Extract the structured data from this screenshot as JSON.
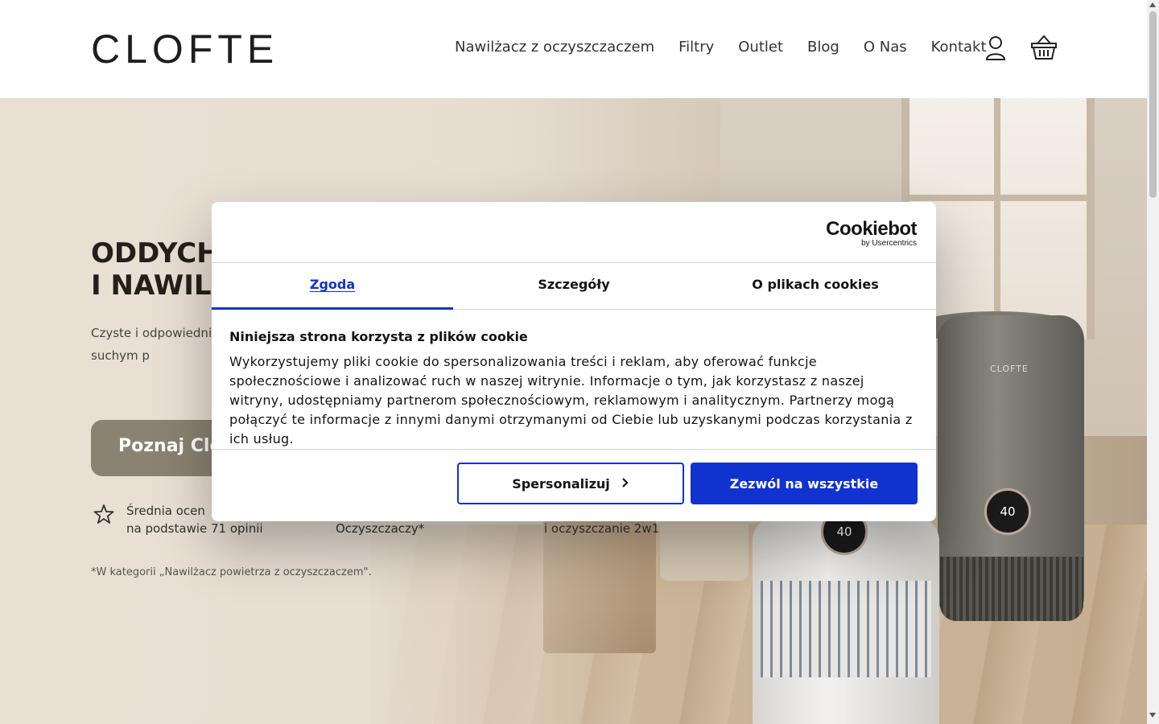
{
  "header": {
    "logo": "CLOFTE",
    "nav": [
      {
        "label": "Nawilżacz z oczyszczaczem"
      },
      {
        "label": "Filtry"
      },
      {
        "label": "Outlet"
      },
      {
        "label": "Blog"
      },
      {
        "label": "O Nas"
      },
      {
        "label": "Kontakt"
      }
    ],
    "icons": [
      "user-icon",
      "cart-icon"
    ]
  },
  "hero": {
    "title_line1": "ODDYCHA",
    "title_line2": "I NAWILŻ",
    "description": "Czyste i odpowiedni ograniczyć suchość związany z suchym p",
    "cta_label": "Poznaj Clo",
    "features": [
      {
        "line1": "Średnia ocen",
        "line2": "na podstawie 71 opinii",
        "icon": "star-icon"
      },
      {
        "line1": "",
        "line2": "Oczyszczaczy*"
      },
      {
        "line1": "",
        "line2": "i oczyszczanie 2w1"
      }
    ],
    "footnote": "*W kategorii „Nawilżacz powietrza z oczyszczaczem\".",
    "device_label": "CLOFTE",
    "display_value": "40"
  },
  "cookie": {
    "brand": "Cookiebot",
    "brand_sub": "by Usercentrics",
    "tabs": [
      {
        "label": "Zgoda",
        "active": true
      },
      {
        "label": "Szczegóły",
        "active": false
      },
      {
        "label": "O plikach cookies",
        "active": false
      }
    ],
    "heading": "Niniejsza strona korzysta z plików cookie",
    "body": "Wykorzystujemy pliki cookie do spersonalizowania treści i reklam, aby oferować funkcje społecznościowe i analizować ruch w naszej witrynie. Informacje o tym, jak korzystasz z naszej witryny, udostępniamy partnerom społecznościowym, reklamowym i analitycznym. Partnerzy mogą połączyć te informacje z innymi danymi otrzymanymi od Ciebie lub uzyskanymi podczas korzystania z ich usług.",
    "customize_label": "Spersonalizuj",
    "allow_label": "Zezwól na wszystkie",
    "accent_color": "#1032cf"
  }
}
